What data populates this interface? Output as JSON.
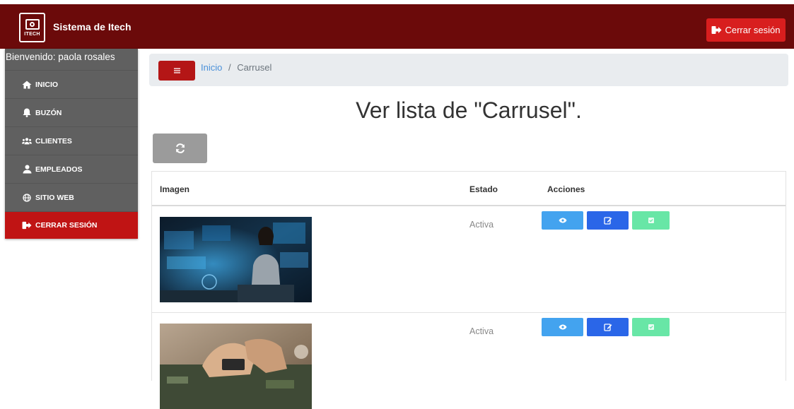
{
  "header": {
    "logo_text": "ITECH",
    "brand": "Sistema de Itech",
    "logout_label": "Cerrar sesión",
    "logout_color": "#d81e1e",
    "bar_color": "#6b0a0a"
  },
  "sidebar": {
    "welcome": "Bienvenido: paola rosales",
    "items": [
      {
        "label": "INICIO",
        "icon": "home-icon"
      },
      {
        "label": "BUZÓN",
        "icon": "bell-icon"
      },
      {
        "label": "CLIENTES",
        "icon": "users-icon"
      },
      {
        "label": "EMPLEADOS",
        "icon": "user-icon"
      },
      {
        "label": "SITIO WEB",
        "icon": "globe-icon"
      },
      {
        "label": "CERRAR SESIÓN",
        "icon": "sign-out-icon"
      }
    ]
  },
  "breadcrumb": {
    "menu_icon": "hamburger-icon",
    "home": "Inicio",
    "separator": "/",
    "current": "Carrusel"
  },
  "page": {
    "title": "Ver lista de \"Carrusel\".",
    "refresh_icon": "refresh-icon"
  },
  "table": {
    "columns": [
      "Imagen",
      "Estado",
      "Acciones"
    ],
    "rows": [
      {
        "image": "woman-with-holographic-screens",
        "estado": "Activa"
      },
      {
        "image": "hands-assembling-circuit-board",
        "estado": "Activa"
      }
    ],
    "action_icons": [
      "eye-icon",
      "edit-icon",
      "check-icon"
    ],
    "action_colors": [
      "#43a3ef",
      "#2a66e8",
      "#68e6a6"
    ]
  }
}
